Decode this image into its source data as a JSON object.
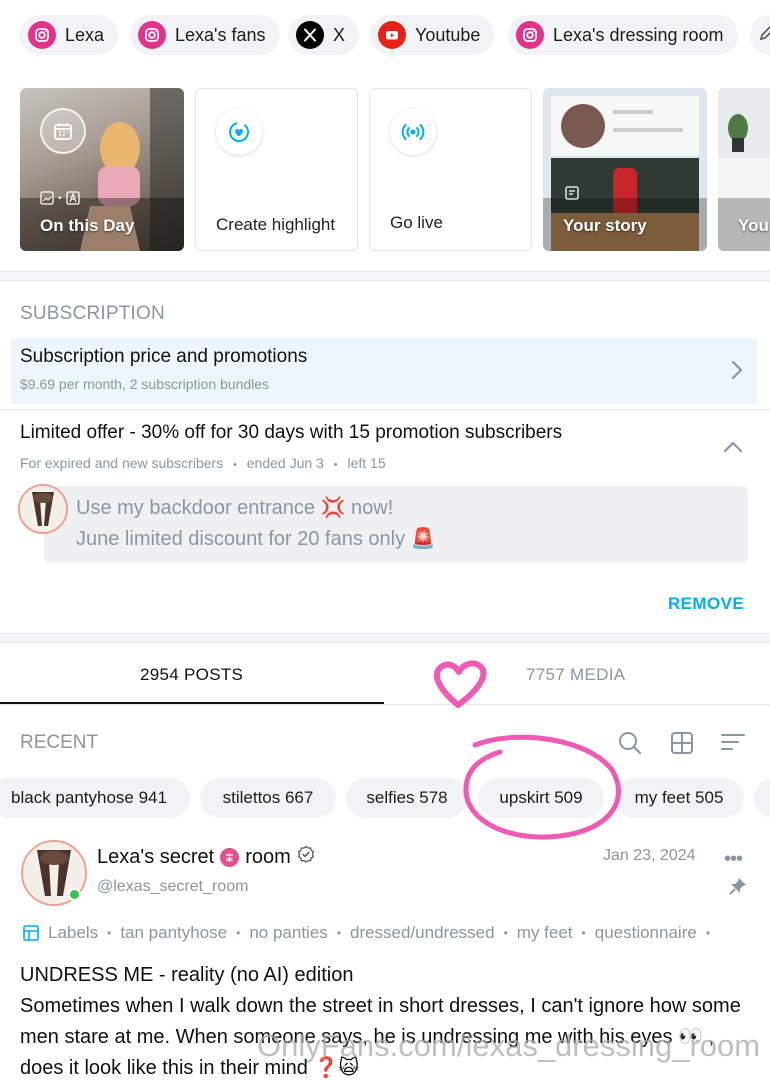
{
  "social_links": [
    {
      "label": "Lexa",
      "icon": "instagram-icon"
    },
    {
      "label": "Lexa's fans",
      "icon": "instagram-icon"
    },
    {
      "label": "X",
      "icon": "x-icon"
    },
    {
      "label": "Youtube",
      "icon": "youtube-icon"
    },
    {
      "label": "Lexa's dressing room",
      "icon": "instagram-icon"
    }
  ],
  "stories": {
    "on_this_day": "On this Day",
    "create_highlight": "Create highlight",
    "go_live": "Go live",
    "your_story": "Your story",
    "partial": "You"
  },
  "subscription": {
    "heading": "SUBSCRIPTION",
    "title": "Subscription price and promotions",
    "description": "$9.69 per month, 2 subscription bundles"
  },
  "offer": {
    "title": "Limited offer - 30% off for 30 days with 15 promotion subscribers",
    "audience": "For expired and new subscribers",
    "ended": "ended Jun 3",
    "left": "left 15",
    "message_line1": "Use my backdoor entrance 💢 now!",
    "message_line2": "June limited discount for 20 fans only 🚨",
    "remove_label": "REMOVE"
  },
  "tabs": {
    "posts": "2954 POSTS",
    "media": "7757 MEDIA"
  },
  "recent": {
    "heading": "RECENT"
  },
  "tags": [
    {
      "label": "black pantyhose 941"
    },
    {
      "label": "stilettos 667"
    },
    {
      "label": "selfies 578"
    },
    {
      "label": "upskirt 509"
    },
    {
      "label": "my feet 505"
    }
  ],
  "post": {
    "name_part1": "Lexa's secret",
    "name_part2": "room",
    "handle": "@lexas_secret_room",
    "date": "Jan 23, 2024",
    "labels_title": "Labels",
    "labels": [
      "tan pantyhose",
      "no panties",
      "dressed/undressed",
      "my feet",
      "questionnaire"
    ],
    "text_line1": "UNDRESS ME - reality (no AI) edition",
    "text_line2": "Sometimes when I walk down the street in short dresses, I can't ignore how some men stare at me. When someone says, he is undressing me with his eyes 👀 , does it look like this in their mind ❓🙀"
  },
  "watermark": "OnlyFans.com/lexas_dressing_room",
  "colors": {
    "accent": "#00aff0",
    "muted": "#8a96a3",
    "instagram": "#e8318a",
    "youtube": "#e62117",
    "annotation": "#f05ab4"
  }
}
